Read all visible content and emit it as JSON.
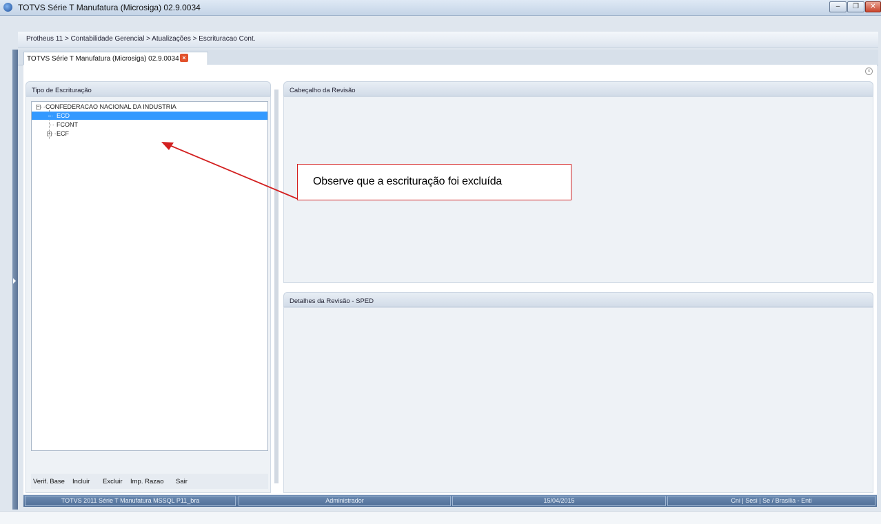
{
  "window": {
    "title": "TOTVS Série T Manufatura (Microsiga) 02.9.0034",
    "controls": {
      "minimize": "–",
      "maximize": "❐",
      "close": "✕"
    }
  },
  "breadcrumb": "Protheus 11 > Contabilidade Gerencial > Atualizações > Escrituracao Cont.",
  "tab": {
    "label": "TOTVS Série T Manufatura (Microsiga) 02.9.0034",
    "close": "×"
  },
  "left_panel": {
    "title": "Tipo de Escrituração",
    "tree": {
      "root": "CONFEDERACAO NACIONAL DA INDUSTRIA",
      "items": [
        {
          "label": "ECD",
          "selected": true
        },
        {
          "label": "FCONT",
          "selected": false
        },
        {
          "label": "ECF",
          "selected": false,
          "expandable": true
        }
      ]
    },
    "actions": [
      "Verif. Base",
      "Incluir",
      "Excluir",
      "Imp. Razao",
      "Sair"
    ]
  },
  "header_panel": {
    "title": "Cabeçalho da Revisão"
  },
  "details_panel": {
    "title": "Detalhes da Revisão - SPED"
  },
  "callout": {
    "text": "Observe que a escrituração  foi excluída",
    "color": "#d32020"
  },
  "statusbar": {
    "product": "TOTVS 2011 Série T Manufatura MSSQL P11_bra",
    "user": "Administrador",
    "date": "15/04/2015",
    "company": "Cni | Sesi | Se / Brasilia - Enti"
  },
  "colors": {
    "selection": "#3399ff",
    "statusbar": "#4e6d96",
    "annotation": "#d32020"
  }
}
